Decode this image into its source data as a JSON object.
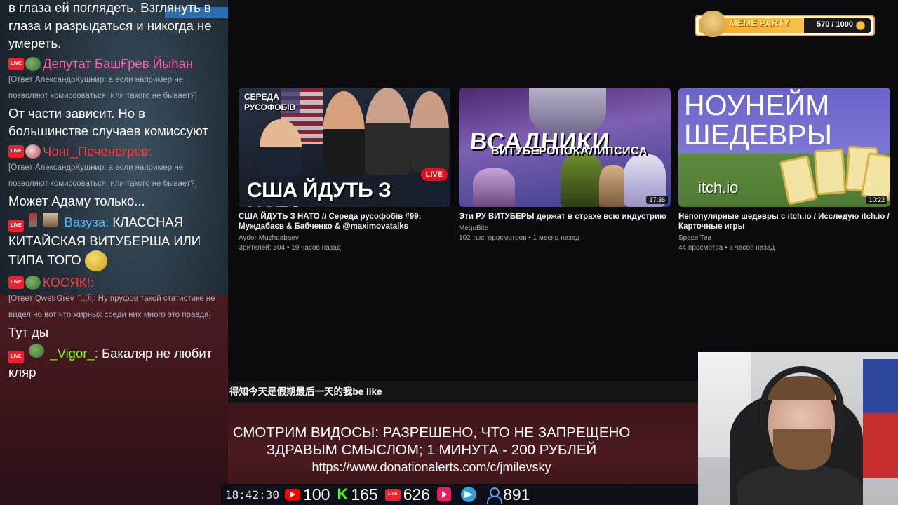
{
  "chat": {
    "messages": [
      {
        "text": "в глаза ей поглядеть. Взглянуть в глаза и разрыдаться и никогда не умереть."
      },
      {
        "user": "Депутат БашҒрев Йыһан",
        "user_color": "#ff5db1",
        "reply": "[Ответ АлександрКушнир: а если например не позволяют комиссоваться, или такого не бывает?]",
        "text": "От части зависит. Но в большинстве случаев комиссуют"
      },
      {
        "user": "Чонг_Печенегрев:",
        "user_color": "#ff3b3b",
        "reply": "[Ответ АлександрКушнир: а если например не позволяют комиссоваться, или такого не бывает?]",
        "text": "Может Адаму только..."
      },
      {
        "user": "Вазуза:",
        "user_color": "#53b8ff",
        "text": "КЛАССНАЯ КИТАЙСКАЯ ВИТУБЕРША ИЛИ ТИПА ТОГО"
      },
      {
        "user": "КОСЯК!:",
        "user_color": "#ff3b3b",
        "reply": "[Ответ QwetrGrev⁻˜..ⓑ: Ну пруфов такой статистике не видел но вот что жирных среди них много это правда]",
        "text": "Тут ды"
      },
      {
        "user": "_Vigor_:",
        "user_color": "#7cfc00",
        "text": "Бакаляр не любит кляр"
      }
    ]
  },
  "videos": [
    {
      "thumb_top": "СЕРЕДА РУСОФОБІВ",
      "thumb_main": "США ЙДУТЬ З НАТО",
      "thumb_badge": "LIVE",
      "title": "США ЙДУТЬ З НАТО // Середа русофобів #99: Муждабаєв & Бабченко & @maximovatalks",
      "channel": "Ayder Muzhdabaev",
      "meta": "Зрителей: 504 • 19 часов назад"
    },
    {
      "thumb_main": "ВСАДНИКИ",
      "thumb_sub": "ВИТУБЕРОПОКАЛИПСИСА",
      "duration": "17:36",
      "title": "Эти РУ ВИТУБЕРЫ держат в страхе всю индустрию",
      "channel": "MeguBite",
      "meta": "102 тыс. просмотров • 1 месяц назад"
    },
    {
      "thumb_main": "НОУНЕЙМ ШЕДЕВРЫ",
      "thumb_sub": "itch.io",
      "duration": "10:22",
      "title": "Непопулярные шедевры с itch.io / Исследую itch.io / Карточные игры",
      "channel": "Space Tea",
      "meta": "44 просмотра • 5 часов назад"
    }
  ],
  "subtitle": "得知今天是假期最后一天的我be like",
  "rules": {
    "line1": "СМОТРИМ ВИДОСЫ: РАЗРЕШЕНО, ЧТО НЕ ЗАПРЕЩЕНО",
    "line2": "ЗДРАВЫМ СМЫСЛОМ; 1 МИНУТА - 200 РУБЛЕЙ",
    "url": "https://www.donationalerts.com/c/jmilevsky"
  },
  "status": {
    "clock": "18:42:30",
    "youtube": "100",
    "kick": "165",
    "vklive": "626",
    "total_viewers": "891"
  },
  "meme_party": {
    "label": "MEME PARTY",
    "progress": "570 / 1000",
    "fill_fraction": 0.57
  },
  "icons": {
    "live_badge": "LIVE",
    "kick": "K"
  },
  "colors": {
    "live_red": "#e8222e",
    "youtube_red": "#ff0000",
    "kick_green": "#53fc18",
    "telegram_blue": "#2aa3df",
    "meme_orange": "#f6a623"
  }
}
